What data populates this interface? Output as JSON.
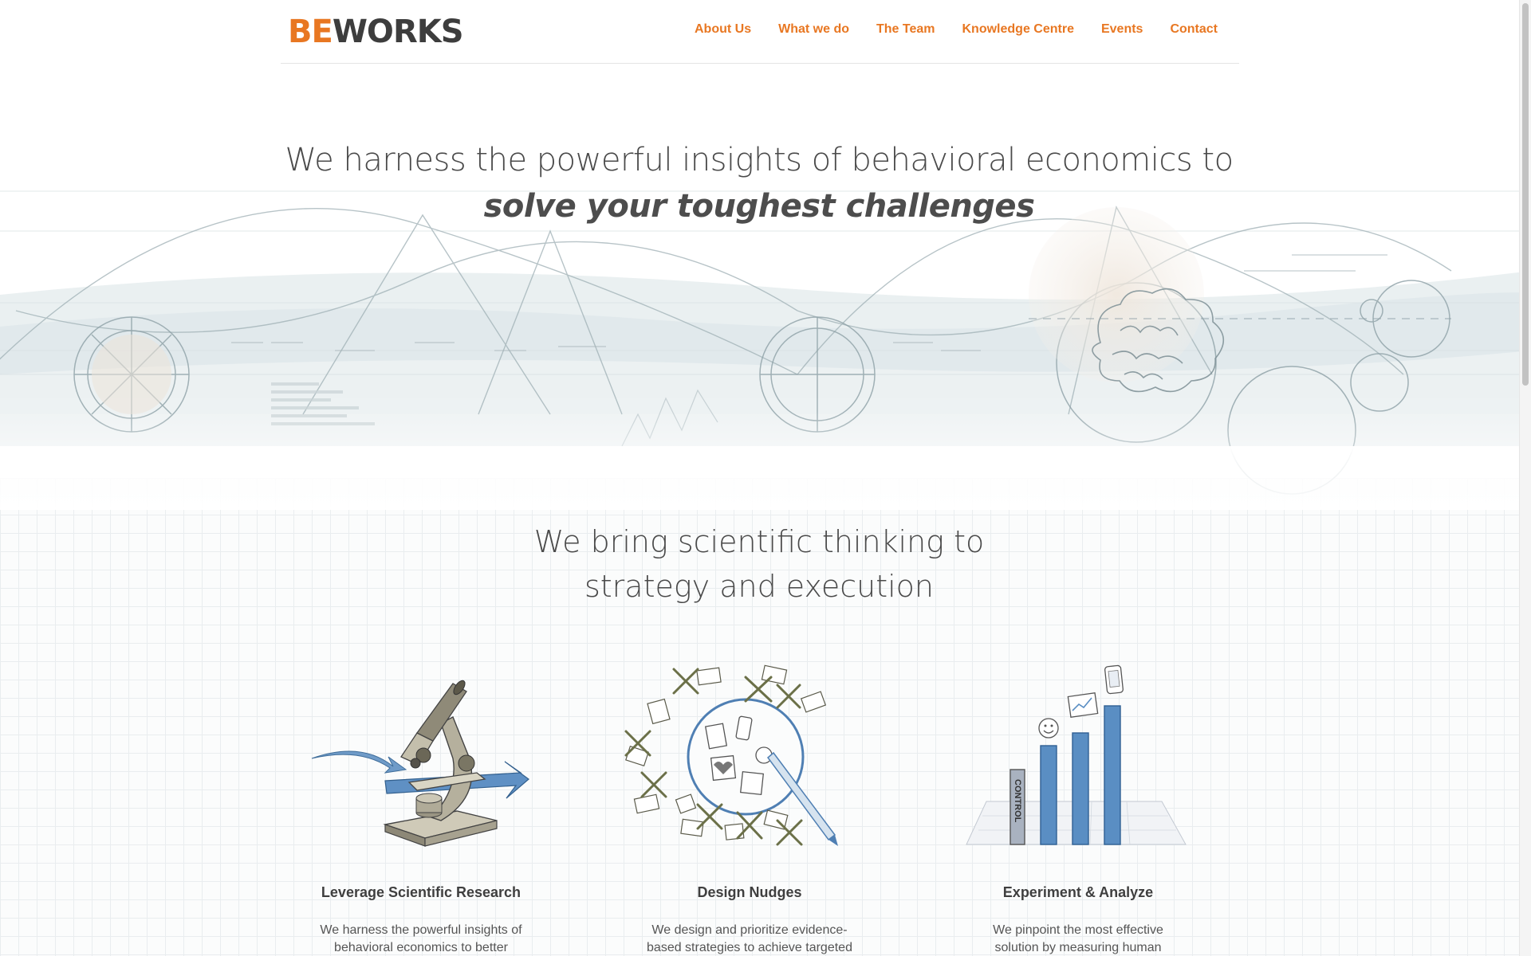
{
  "colors": {
    "accent": "#e87722",
    "text": "#4a4a4a",
    "bar_blue": "#5a8ec3"
  },
  "brand": {
    "logo_be": "BE",
    "logo_works": "WORKS"
  },
  "nav": [
    "About Us",
    "What we do",
    "The Team",
    "Knowledge Centre",
    "Events",
    "Contact"
  ],
  "hero": {
    "line1": "We harness the powerful insights of behavioral economics to",
    "line2": "solve your toughest challenges"
  },
  "section": {
    "title_line1": "We bring scientific thinking to",
    "title_line2": "strategy and execution"
  },
  "cards": [
    {
      "icon": "microscope-icon",
      "title": "Leverage Scientific Research",
      "text": "We harness the powerful insights of behavioral economics to better"
    },
    {
      "icon": "nudges-sketch-icon",
      "title": "Design Nudges",
      "text": "We design and prioritize evidence-based strategies to achieve targeted behaviors"
    },
    {
      "icon": "bar-chart-icon",
      "title": "Experiment & Analyze",
      "text": "We pinpoint the most effective solution by measuring human",
      "chart_label": "CONTROL"
    }
  ]
}
